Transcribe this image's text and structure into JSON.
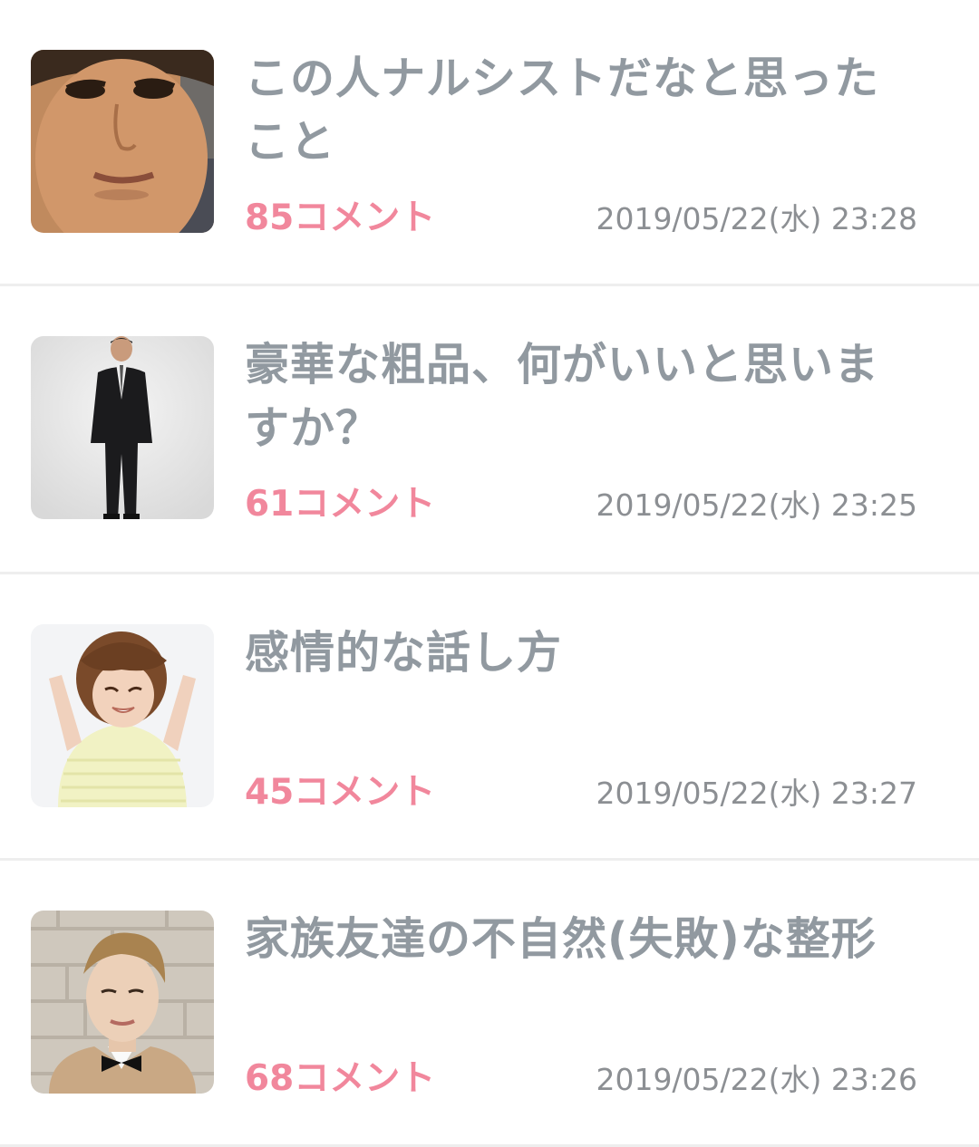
{
  "topics": [
    {
      "title": "この人ナルシストだなと思ったこと",
      "comments": "85コメント",
      "date": "2019/05/22(水) 23:28",
      "thumb_icon": "man-face-photo"
    },
    {
      "title": "豪華な粗品、何がいいと思いますか？",
      "comments": "61コメント",
      "date": "2019/05/22(水) 23:25",
      "thumb_icon": "man-in-suit-photo"
    },
    {
      "title": "感情的な話し方",
      "comments": "45コメント",
      "date": "2019/05/22(水) 23:27",
      "thumb_icon": "stressed-woman-photo"
    },
    {
      "title": "家族友達の不自然(失敗)な整形",
      "comments": "68コメント",
      "date": "2019/05/22(水) 23:26",
      "thumb_icon": "man-bowtie-photo"
    }
  ],
  "colors": {
    "title": "#9199a0",
    "comments": "#f1879c",
    "date": "#8c8f93",
    "divider": "#eeeeee"
  }
}
